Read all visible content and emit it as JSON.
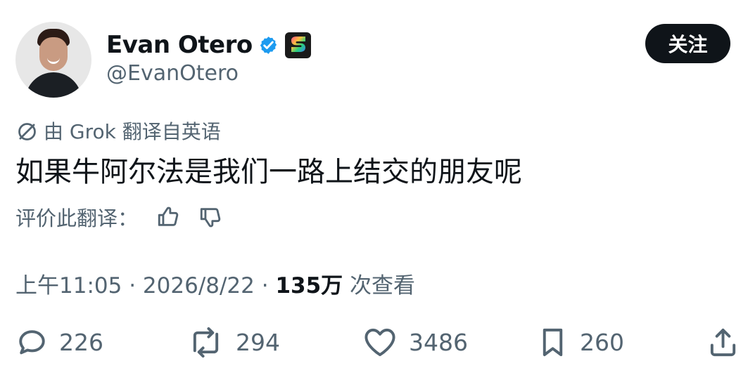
{
  "tweet": {
    "author": {
      "display_name": "Evan Otero",
      "handle": "@EvanOtero"
    },
    "follow_label": "关注",
    "translation": {
      "source_label": "由 Grok 翻译自英语",
      "text": "如果牛阿尔法是我们一路上结交的朋友呢",
      "rate_label": "评价此翻译："
    },
    "meta": {
      "time": "上午11:05",
      "separator": "·",
      "date": "2026/8/22",
      "views_count": "135万",
      "views_label": "次查看"
    },
    "actions": {
      "reply_count": "226",
      "repost_count": "294",
      "like_count": "3486",
      "bookmark_count": "260"
    }
  },
  "icons": {
    "verified": "verified-badge-icon",
    "app": "s-app-icon",
    "translate": "translate-slash-icon",
    "thumbs_up": "thumbs-up-icon",
    "thumbs_down": "thumbs-down-icon",
    "reply": "reply-icon",
    "repost": "repost-icon",
    "like": "heart-icon",
    "bookmark": "bookmark-icon",
    "share": "share-icon"
  },
  "colors": {
    "text_primary": "#0f1419",
    "text_secondary": "#536471",
    "follow_button_bg": "#0f1419",
    "verified_blue": "#1d9bf0"
  }
}
